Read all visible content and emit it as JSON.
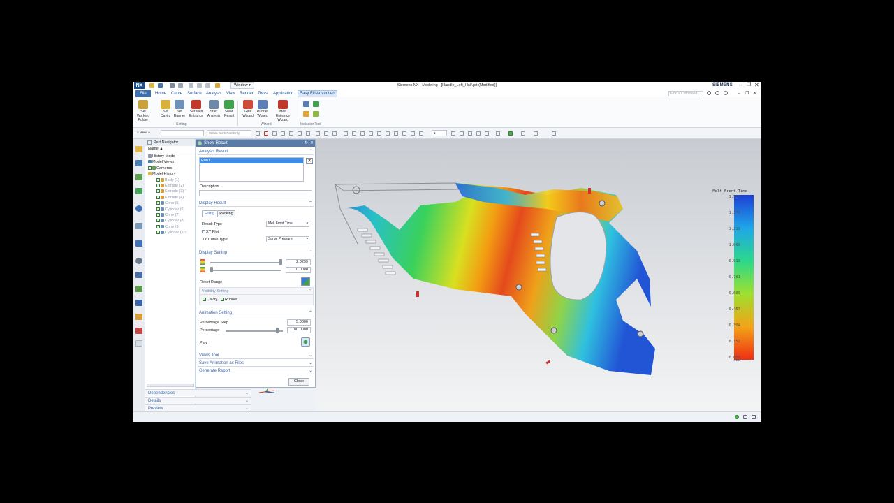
{
  "titlebar": {
    "logo": "NX",
    "window_menu": "Window",
    "title": "Siemens NX - Modeling - [Handle_Left_Half.prt (Modified)]",
    "brand": "SIEMENS"
  },
  "menubar": {
    "file": "File",
    "tabs": [
      "Home",
      "Curve",
      "Surface",
      "Analysis",
      "View",
      "Render",
      "Tools",
      "Application",
      "Easy Fill Advanced"
    ],
    "command_search_placeholder": "Find a Command"
  },
  "ribbon": {
    "buttons": [
      {
        "label": "Set Working Folder",
        "icon": "folder-icon",
        "color": "#c9a33a"
      },
      {
        "label": "Set Cavity",
        "icon": "cavity-icon",
        "color": "#d8b13c"
      },
      {
        "label": "Set Runner",
        "icon": "runner-icon",
        "color": "#6f8fb6"
      },
      {
        "label": "Set Melt Entrance",
        "icon": "melt-entrance-icon",
        "color": "#c0392b"
      },
      {
        "label": "Start Analysis",
        "icon": "analysis-icon",
        "color": "#6f8aa8"
      },
      {
        "label": "Show Result",
        "icon": "result-icon",
        "color": "#3fa34d"
      },
      {
        "label": "Gate Wizard",
        "icon": "gate-wizard-icon",
        "color": "#d04a3a"
      },
      {
        "label": "Runner Wizard",
        "icon": "runner-wizard-icon",
        "color": "#5a7fb8"
      },
      {
        "label": "Melt Entrance Wizard",
        "icon": "melt-wizard-icon",
        "color": "#c0392b"
      }
    ],
    "groups": [
      "Setting",
      "Wizard",
      "Indicator Tool"
    ]
  },
  "toolbar": {
    "menu_label": "Menu",
    "filter_placeholder": "",
    "scope_value": "Within Work Part Only",
    "layer_value": "1"
  },
  "part_navigator": {
    "title": "Part Navigator",
    "column": "Name",
    "items": [
      {
        "label": "History Mode",
        "indent": 0,
        "checked": false
      },
      {
        "label": "Model Views",
        "indent": 0,
        "checked": false
      },
      {
        "label": "Cameras",
        "indent": 0,
        "checked": true
      },
      {
        "label": "Model History",
        "indent": 0,
        "checked": false
      },
      {
        "label": "Body (1)",
        "indent": 1,
        "checked": true
      },
      {
        "label": "Extrude (2) \"",
        "indent": 1,
        "checked": true
      },
      {
        "label": "Extrude (3) \"",
        "indent": 1,
        "checked": true
      },
      {
        "label": "Extrude (4) \"",
        "indent": 1,
        "checked": true
      },
      {
        "label": "Cone (5)",
        "indent": 1,
        "checked": true
      },
      {
        "label": "Cylinder (6)",
        "indent": 1,
        "checked": true
      },
      {
        "label": "Cone (7)",
        "indent": 1,
        "checked": true
      },
      {
        "label": "Cylinder (8)",
        "indent": 1,
        "checked": true
      },
      {
        "label": "Cone (9)",
        "indent": 1,
        "checked": true
      },
      {
        "label": "Cylinder (10)",
        "indent": 1,
        "checked": true
      }
    ],
    "panels": [
      "Dependencies",
      "Details",
      "Preview"
    ]
  },
  "dialog": {
    "title": "Show Result",
    "analysis_result": {
      "header": "Analysis Result",
      "selected_run": "Run1",
      "description_label": "Description",
      "description_value": ""
    },
    "display_result": {
      "header": "Display Result",
      "tabs": [
        "Filling",
        "Packing"
      ],
      "result_type_label": "Result Type",
      "result_type_value": "Melt Front Time",
      "xy_plot_label": "XY Plot",
      "xy_curve_type_label": "XY Curve Type",
      "xy_curve_type_value": "Sprue Pressure"
    },
    "display_setting": {
      "header": "Display Setting",
      "max_value": "2.0299",
      "min_value": "0.0000",
      "reset_range_label": "Reset Range",
      "visibility_header": "Visibility Setting",
      "cavity_label": "Cavity",
      "runner_label": "Runner"
    },
    "animation_setting": {
      "header": "Animation Setting",
      "percentage_step_label": "Percentage Step",
      "percentage_step_value": "5.0000",
      "percentage_label": "Percentage",
      "percentage_value": "100.0000",
      "percentage_fraction": 0.92,
      "play_label": "Play"
    },
    "collapsed_sections": [
      "Views Tool",
      "Save Animation as Files",
      "Generate Report"
    ],
    "close_label": "Close"
  },
  "legend": {
    "title": "Melt Front Time",
    "unit": "sec",
    "values": [
      "1.522",
      "1.370",
      "1.218",
      "1.066",
      "0.913",
      "0.761",
      "0.609",
      "0.457",
      "0.304",
      "0.152",
      "0.000"
    ]
  }
}
